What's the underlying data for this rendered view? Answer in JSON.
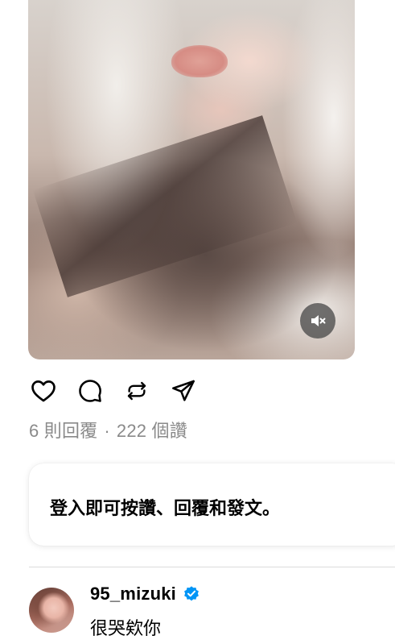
{
  "post": {
    "media": {
      "type": "video",
      "mute_icon": "speaker-muted-icon"
    },
    "actions": [
      {
        "name": "like",
        "icon": "heart-icon"
      },
      {
        "name": "reply",
        "icon": "comment-bubble-icon"
      },
      {
        "name": "repost",
        "icon": "repost-icon"
      },
      {
        "name": "share",
        "icon": "send-icon"
      }
    ],
    "stats": {
      "replies": "6 則回覆",
      "separator": "·",
      "likes": "222 個讚"
    }
  },
  "login_prompt": {
    "text": "登入即可按讚、回覆和發文。"
  },
  "reply": {
    "username": "95_mizuki",
    "verified": true,
    "verified_color": "#0095f6",
    "text": "很哭欸你"
  }
}
